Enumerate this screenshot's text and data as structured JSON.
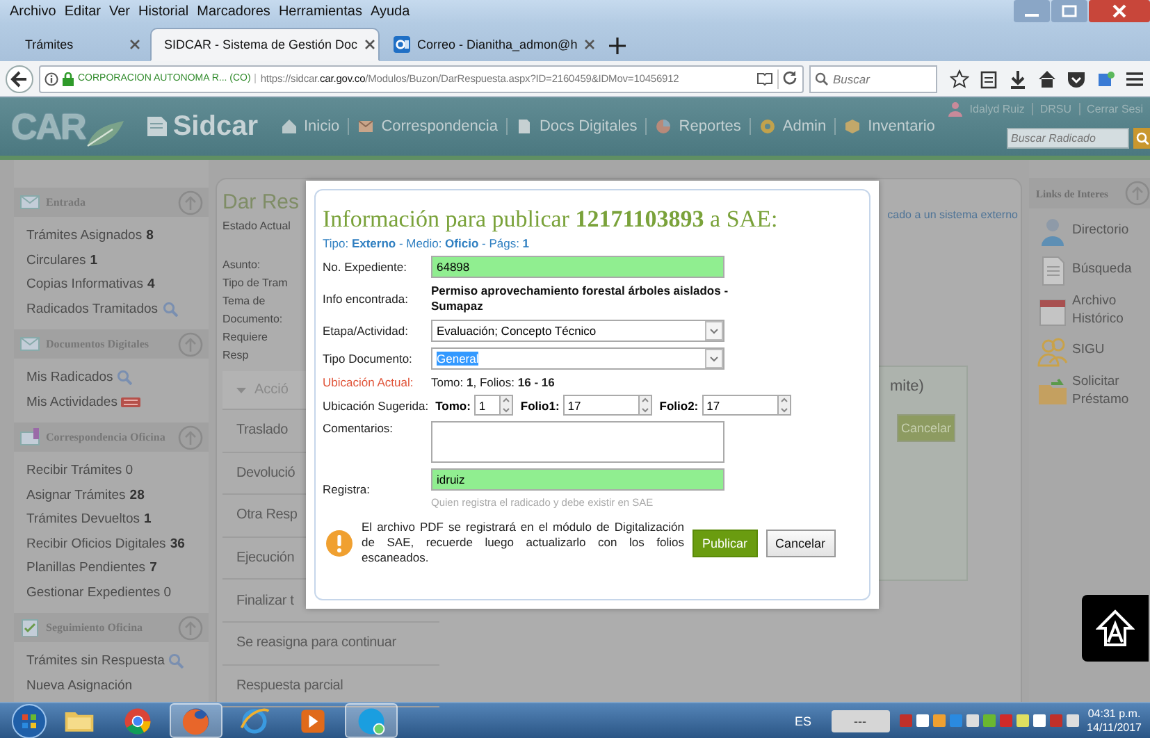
{
  "browser": {
    "menu": [
      "Archivo",
      "Editar",
      "Ver",
      "Historial",
      "Marcadores",
      "Herramientas",
      "Ayuda"
    ],
    "tabs": [
      {
        "label": "Trámites",
        "selected": false
      },
      {
        "label": "SIDCAR - Sistema de Gestión Doc",
        "selected": true
      },
      {
        "label": "Correo - Dianitha_admon@h",
        "selected": false
      }
    ],
    "identity": "CORPORACION AUTONOMA R...  (CO)",
    "url": "https://sidcar.**car.gov.co**/Modulos/Buzon/DarRespuesta.aspx?ID=2160459&IDMov=10456912",
    "search": {
      "placeholder": "Buscar"
    }
  },
  "header": {
    "logo": "CAR",
    "app_name": "Sidcar",
    "nav": [
      {
        "label": "Inicio"
      },
      {
        "label": "Correspondencia"
      },
      {
        "label": "Docs Digitales"
      },
      {
        "label": "Reportes"
      },
      {
        "label": "Admin"
      },
      {
        "label": "Inventario"
      }
    ],
    "user_links": [
      "Idalyd Ruiz",
      "DRSU",
      "Cerrar Sesi"
    ],
    "search": {
      "placeholder": "Buscar Radicado"
    }
  },
  "sidebar": [
    {
      "title": "Entrada",
      "items": [
        {
          "label": "Trámites Asignados **8**",
          "kind": "text"
        },
        {
          "label": "Circulares **1**",
          "kind": "text"
        },
        {
          "label": "Copias Informativas **4**",
          "kind": "text"
        },
        {
          "label": "Radicados Tramitados",
          "kind": "search"
        }
      ]
    },
    {
      "title": "Documentos Digitales",
      "items": [
        {
          "label": "Mis Radicados",
          "kind": "search"
        },
        {
          "label": "Mis Actividades",
          "kind": "new"
        }
      ]
    },
    {
      "title": "Correspondencia Oficina",
      "items": [
        {
          "label": "Recibir Trámites 0",
          "kind": "text"
        },
        {
          "label": "Asignar Trámites **28**",
          "kind": "text"
        },
        {
          "label": "Trámites Devueltos **1**",
          "kind": "text"
        },
        {
          "label": "Recibir Oficios Digitales **36**",
          "kind": "text"
        },
        {
          "label": "Planillas Pendientes **7**",
          "kind": "text"
        },
        {
          "label": "Gestionar Expedientes 0",
          "kind": "text"
        }
      ]
    },
    {
      "title": "Seguimiento Oficina",
      "items": [
        {
          "label": "Trámites sin Respuesta",
          "kind": "search"
        },
        {
          "label": "Nueva Asignación",
          "kind": "text"
        }
      ]
    }
  ],
  "main": {
    "title": "Dar Res",
    "fields": [
      "Estado Actual",
      "Asunto:",
      "Tipo de Tram",
      "Tema de Documento:",
      "Requiere Resp"
    ],
    "actions_header": "Acció",
    "actions": [
      "Traslado",
      "Devolució",
      "Otra Resp",
      "Ejecución",
      "Finalizar t",
      "Se reasigna para continuar",
      "Respuesta parcial"
    ],
    "note": "cado a un sistema externo",
    "panel": {
      "text": "mite)",
      "button": "Cancelar"
    }
  },
  "links": {
    "title": "Links de Interes",
    "items": [
      "Directorio",
      "Búsqueda",
      "Archivo Histórico",
      "SIGU",
      "Solicitar Préstamo"
    ]
  },
  "dialog": {
    "title": "Información para publicar **12171103893** a SAE:",
    "subtitle": "Tipo: **Externo** - Medio: **Oficio** - Págs: **1**",
    "expediente": {
      "label": "No. Expediente:",
      "value": "64898",
      "valid": true
    },
    "info": {
      "label": "Info encontrada:",
      "value": "Permiso aprovechamiento forestal árboles aislados - Sumapaz"
    },
    "etapa": {
      "label": "Etapa/Actividad:",
      "value": "Evaluación; Concepto Técnico"
    },
    "tipo_documento": {
      "label": "Tipo Documento:",
      "value": "General",
      "text_selected": true
    },
    "ubicacion_actual": {
      "label": "Ubicación Actual:",
      "value": "Tomo: **1**, Folios: **16 - 16**"
    },
    "ubicacion_sugerida": {
      "label": "Ubicación Sugerida:",
      "spinners": [
        {
          "label": "Tomo:",
          "value": "1"
        },
        {
          "label": "Folio1:",
          "value": "17"
        },
        {
          "label": "Folio2:",
          "value": "17"
        }
      ]
    },
    "comentarios": {
      "label": "Comentarios:"
    },
    "registra": {
      "label": "Registra:",
      "value": "idruiz",
      "valid": true,
      "hint": "Quien registra el radicado y debe existir en SAE"
    },
    "warning": "El archivo PDF se registrará en el módulo de Digitalización de SAE, recuerde luego actualizarlo con los folios escaneados.",
    "buttons": [
      {
        "label": "Publicar",
        "primary": true
      },
      {
        "label": "Cancelar",
        "primary": false
      }
    ]
  },
  "taskbar": {
    "apps": [
      {
        "running": false
      },
      {
        "running": false
      },
      {
        "running": true
      },
      {
        "running": false
      },
      {
        "running": false
      },
      {
        "running": true
      }
    ],
    "language": "ES",
    "toolbar": "---",
    "time": "04:31 p.m.",
    "date": "14/11/2017"
  }
}
